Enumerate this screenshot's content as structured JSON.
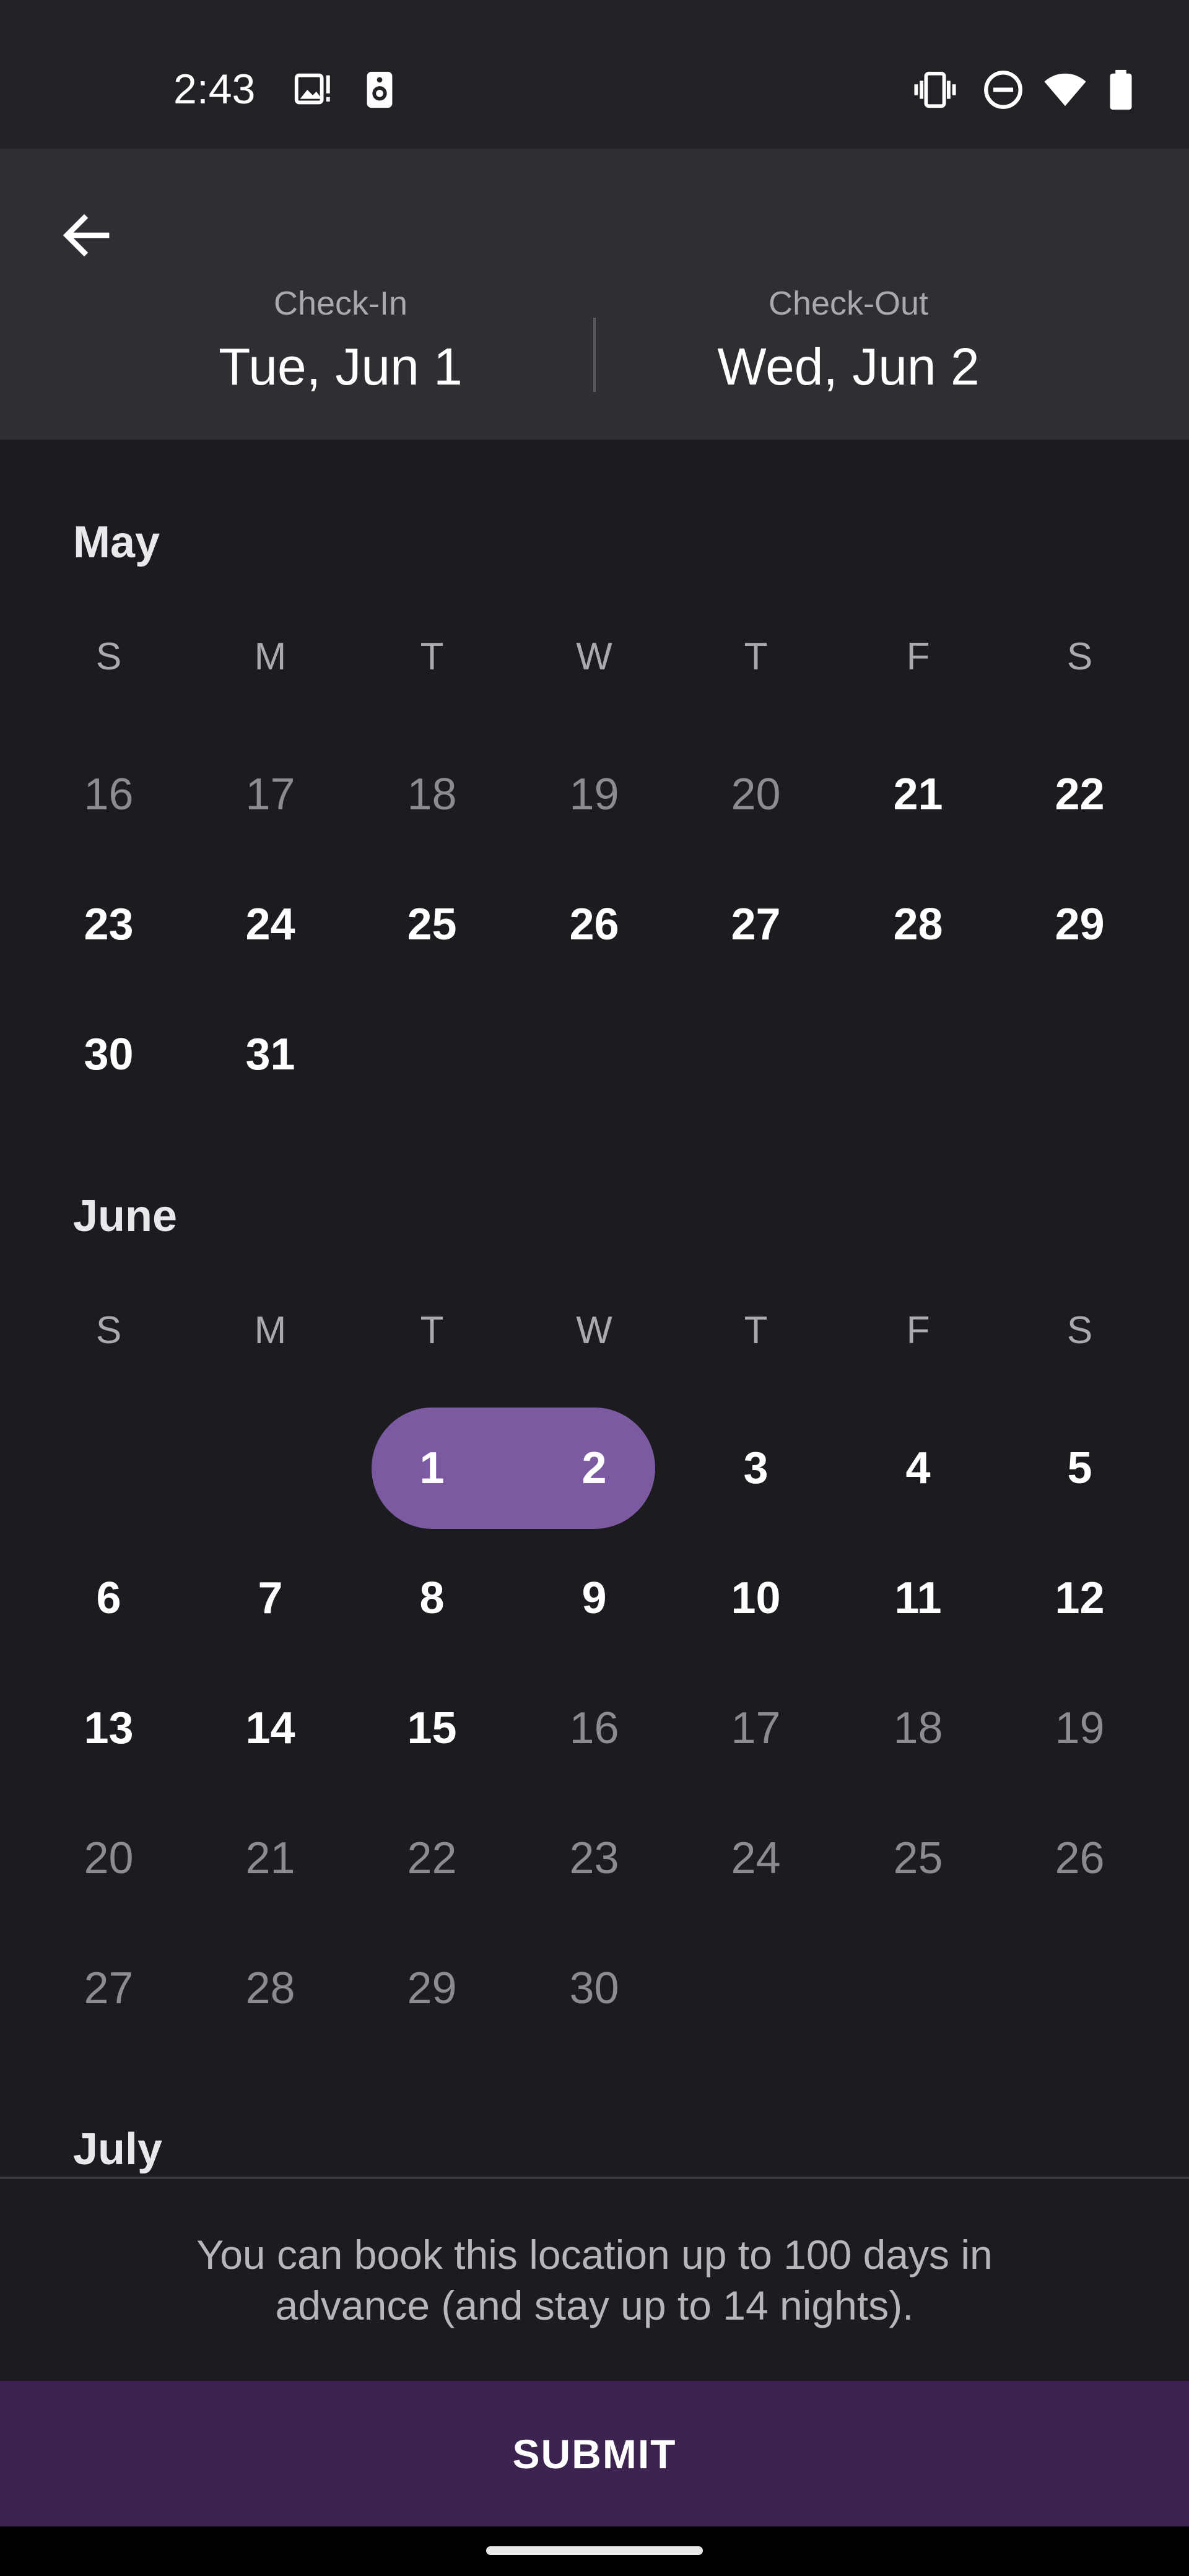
{
  "status_bar": {
    "time": "2:43",
    "left_icons": [
      "image-alert-icon",
      "speaker-icon"
    ],
    "right_icons": [
      "vibrate-icon",
      "do-not-disturb-icon",
      "wifi-icon",
      "battery-icon"
    ]
  },
  "header": {
    "back_icon": "arrow-left-icon",
    "check_in": {
      "label": "Check-In",
      "value": "Tue, Jun 1"
    },
    "check_out": {
      "label": "Check-Out",
      "value": "Wed, Jun 2"
    }
  },
  "calendar": {
    "weekdays": [
      "S",
      "M",
      "T",
      "W",
      "T",
      "F",
      "S"
    ],
    "may": {
      "title": "May",
      "rows": [
        [
          [
            "16",
            "d"
          ],
          [
            "17",
            "d"
          ],
          [
            "18",
            "d"
          ],
          [
            "19",
            "d"
          ],
          [
            "20",
            "d"
          ],
          [
            "21",
            "e"
          ],
          [
            "22",
            "e"
          ]
        ],
        [
          [
            "23",
            "e"
          ],
          [
            "24",
            "e"
          ],
          [
            "25",
            "e"
          ],
          [
            "26",
            "e"
          ],
          [
            "27",
            "e"
          ],
          [
            "28",
            "e"
          ],
          [
            "29",
            "e"
          ]
        ],
        [
          [
            "30",
            "e"
          ],
          [
            "31",
            "e"
          ],
          null,
          null,
          null,
          null,
          null
        ]
      ]
    },
    "june": {
      "title": "June",
      "rows": [
        [
          null,
          null,
          [
            "1",
            "s"
          ],
          [
            "2",
            "s"
          ],
          [
            "3",
            "e"
          ],
          [
            "4",
            "e"
          ],
          [
            "5",
            "e"
          ]
        ],
        [
          [
            "6",
            "e"
          ],
          [
            "7",
            "e"
          ],
          [
            "8",
            "e"
          ],
          [
            "9",
            "e"
          ],
          [
            "10",
            "e"
          ],
          [
            "11",
            "e"
          ],
          [
            "12",
            "e"
          ]
        ],
        [
          [
            "13",
            "e"
          ],
          [
            "14",
            "e"
          ],
          [
            "15",
            "e"
          ],
          [
            "16",
            "d"
          ],
          [
            "17",
            "d"
          ],
          [
            "18",
            "d"
          ],
          [
            "19",
            "d"
          ]
        ],
        [
          [
            "20",
            "d"
          ],
          [
            "21",
            "d"
          ],
          [
            "22",
            "d"
          ],
          [
            "23",
            "d"
          ],
          [
            "24",
            "d"
          ],
          [
            "25",
            "d"
          ],
          [
            "26",
            "d"
          ]
        ],
        [
          [
            "27",
            "d"
          ],
          [
            "28",
            "d"
          ],
          [
            "29",
            "d"
          ],
          [
            "30",
            "d"
          ],
          null,
          null,
          null
        ]
      ]
    },
    "july": {
      "title": "July"
    }
  },
  "info": {
    "text": "You can book this location up to 100 days in advance (and stay up to 14 nights)."
  },
  "submit": {
    "label": "SUBMIT"
  },
  "colors": {
    "accent": "#7b5aa1",
    "submit_bg": "#3c2350"
  }
}
